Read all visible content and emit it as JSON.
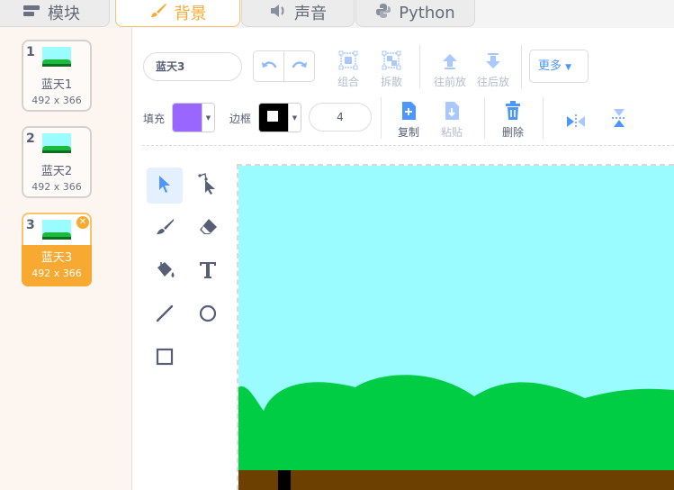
{
  "tabs": [
    {
      "label": "模块",
      "icon": "blocks-icon"
    },
    {
      "label": "背景",
      "icon": "brush-icon",
      "active": true
    },
    {
      "label": "声音",
      "icon": "speaker-icon"
    },
    {
      "label": "Python",
      "icon": "python-icon"
    }
  ],
  "costumes": [
    {
      "number": "1",
      "name": "蓝天1",
      "size": "492 x 366"
    },
    {
      "number": "2",
      "name": "蓝天2",
      "size": "492 x 366"
    },
    {
      "number": "3",
      "name": "蓝天3",
      "size": "492 x 366",
      "selected": true
    }
  ],
  "editor": {
    "costume_name": "蓝天3",
    "group_label": "组合",
    "ungroup_label": "拆散",
    "forward_label": "往前放",
    "backward_label": "往后放",
    "more_label": "更多",
    "fill_label": "填充",
    "outline_label": "边框",
    "outline_width": "4",
    "copy_label": "复制",
    "paste_label": "粘贴",
    "delete_label": "删除"
  },
  "colors": {
    "fill": "#9966ff",
    "outline": "#000000",
    "sky": "#9bfcff",
    "grass": "#00cc44",
    "ground": "#6b4000",
    "accent": "#f7a932",
    "blue": "#4c97ff"
  },
  "palette_tools": [
    "select-icon",
    "reshape-icon",
    "brush-icon",
    "eraser-icon",
    "fill-icon",
    "text-icon",
    "line-icon",
    "circle-icon",
    "rectangle-icon"
  ]
}
